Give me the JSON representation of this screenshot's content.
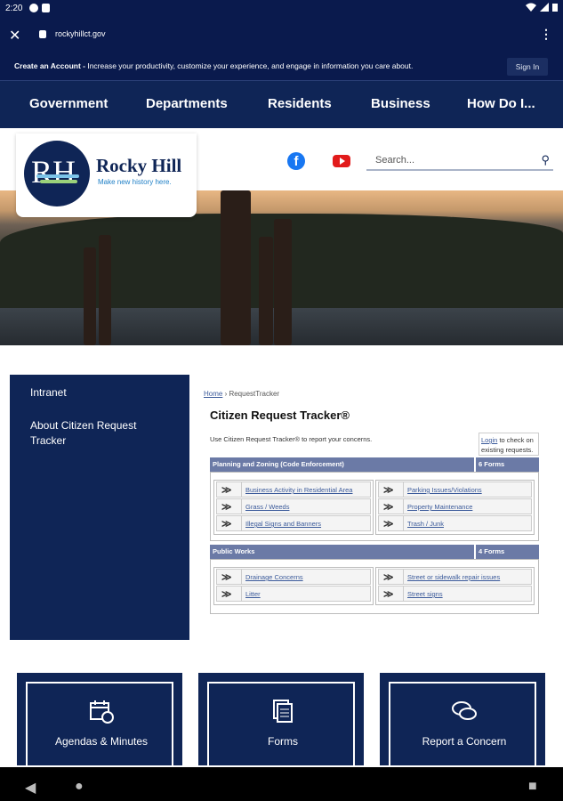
{
  "status_bar": {
    "time": "2:20"
  },
  "browser": {
    "url": "rockyhillct.gov"
  },
  "account_bar": {
    "lead": "Create an Account -",
    "message": " Increase your productivity, customize your experience, and engage in information you care about.",
    "signin": "Sign In"
  },
  "nav": {
    "items": [
      "Government",
      "Departments",
      "Residents",
      "Business",
      "How Do I..."
    ]
  },
  "logo": {
    "initials": "RH",
    "name": "Rocky Hill",
    "tagline": "Make new history here."
  },
  "search": {
    "placeholder": "Search..."
  },
  "sidebar": {
    "items": [
      "Intranet",
      "About Citizen Request Tracker"
    ]
  },
  "breadcrumb": {
    "home": "Home",
    "sep": " › ",
    "current": "RequestTracker"
  },
  "page": {
    "title": "Citizen Request Tracker®",
    "intro": "Use Citizen Request Tracker® to report your concerns.",
    "login_link": "Login",
    "login_text": " to check on existing requests."
  },
  "sections": [
    {
      "title": "Planning and Zoning (Code Enforcement)",
      "count": "6 Forms",
      "left": [
        "Business Activity in Residential Area",
        "Grass / Weeds",
        "Illegal Signs and Banners"
      ],
      "right": [
        "Parking Issues/Violations",
        "Property Maintenance",
        "Trash / Junk"
      ]
    },
    {
      "title": "Public Works",
      "count": "4 Forms",
      "left": [
        "Drainage Concerns",
        "Litter"
      ],
      "right": [
        "Street or sidewalk repair issues",
        "Street signs"
      ]
    }
  ],
  "tiles": [
    {
      "label": "Agendas & Minutes",
      "icon": "calendar-icon"
    },
    {
      "label": "Forms",
      "icon": "documents-icon"
    },
    {
      "label": "Report a Concern",
      "icon": "chat-bubbles-icon"
    }
  ],
  "colors": {
    "navy": "#0f2556",
    "section_header": "#6b7aa6",
    "link": "#3b5a9a"
  }
}
